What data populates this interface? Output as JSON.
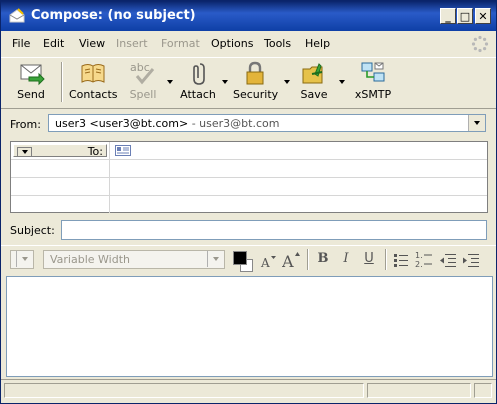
{
  "window": {
    "title": "Compose: (no subject)",
    "min_glyph": "_",
    "max_glyph": "□",
    "close_glyph": "✕"
  },
  "menu": [
    {
      "label": "File",
      "disabled": false
    },
    {
      "label": "Edit",
      "disabled": false
    },
    {
      "label": "View",
      "disabled": false
    },
    {
      "label": "Insert",
      "disabled": true
    },
    {
      "label": "Format",
      "disabled": true
    },
    {
      "label": "Options",
      "disabled": false
    },
    {
      "label": "Tools",
      "disabled": false
    },
    {
      "label": "Help",
      "disabled": false
    }
  ],
  "toolbar": {
    "send": "Send",
    "contacts": "Contacts",
    "spell": "Spell",
    "attach": "Attach",
    "security": "Security",
    "save": "Save",
    "xsmtp": "xSMTP"
  },
  "from": {
    "label": "From:",
    "value": "user3 <user3@bt.com>",
    "account": " - user3@bt.com"
  },
  "recipients": {
    "type_label": "To:",
    "rows": 4
  },
  "subject": {
    "label": "Subject:",
    "value": ""
  },
  "format": {
    "paragraph_style": "",
    "font": "Variable Width",
    "bold": "B",
    "italic": "I",
    "underline": "U"
  },
  "colors": {
    "title_bar": "#0a246a",
    "window_bg": "#ece9d8",
    "field_border": "#7f9db9"
  }
}
